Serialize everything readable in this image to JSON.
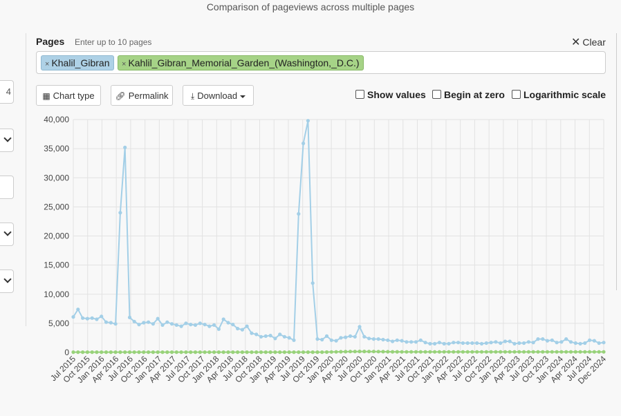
{
  "header": {
    "title": "Comparison of pageviews across multiple pages"
  },
  "left_panel": {
    "field_value": "4"
  },
  "pages": {
    "label": "Pages",
    "hint": "Enter up to 10 pages",
    "clear_label": "Clear",
    "tags": [
      "Khalil_Gibran",
      "Kahlil_Gibran_Memorial_Garden_(Washington,_D.C.)"
    ]
  },
  "toolbar": {
    "chart_type_label": "Chart type",
    "permalink_label": "Permalink",
    "download_label": "Download",
    "show_values_label": "Show values",
    "begin_at_zero_label": "Begin at zero",
    "log_scale_label": "Logarithmic scale"
  },
  "colors": {
    "series1": "#a3cfe7",
    "series2": "#98d27a",
    "grid": "#e2e2e2"
  },
  "chart_data": {
    "type": "line",
    "ylim": [
      0,
      40000
    ],
    "yticks": [
      0,
      5000,
      10000,
      15000,
      20000,
      25000,
      30000,
      35000,
      40000
    ],
    "ytick_labels": [
      "0",
      "5,000",
      "10,000",
      "15,000",
      "20,000",
      "25,000",
      "30,000",
      "35,000",
      "40,000"
    ],
    "x_start": "Jul 2015",
    "x_end": "Dec 2024",
    "xtick_labels": [
      "Jul 2015",
      "Oct 2015",
      "Jan 2016",
      "Apr 2016",
      "Jul 2016",
      "Oct 2016",
      "Jan 2017",
      "Apr 2017",
      "Jul 2017",
      "Oct 2017",
      "Jan 2018",
      "Apr 2018",
      "Jul 2018",
      "Oct 2018",
      "Jan 2019",
      "Apr 2019",
      "Jul 2019",
      "Oct 2019",
      "Jan 2020",
      "Apr 2020",
      "Jul 2020",
      "Oct 2020",
      "Jan 2021",
      "Apr 2021",
      "Jul 2021",
      "Oct 2021",
      "Jan 2022",
      "Apr 2022",
      "Jul 2022",
      "Oct 2022",
      "Jan 2023",
      "Apr 2023",
      "Jul 2023",
      "Oct 2023",
      "Jan 2024",
      "Apr 2024",
      "Jul 2024",
      "Dec 2024"
    ],
    "series": [
      {
        "values": [
          6100,
          7400,
          5900,
          5800,
          5900,
          5700,
          6200,
          5200,
          5100,
          4900,
          24000,
          35200,
          6000,
          5300,
          4800,
          5100,
          5200,
          4900,
          5800,
          4700,
          5200,
          4900,
          4700,
          4500,
          5000,
          4800,
          4700,
          5000,
          4800,
          4500,
          4700,
          4000,
          5700,
          5100,
          4800,
          4100,
          3900,
          4500,
          3300,
          3100,
          2700,
          2800,
          2900,
          2400,
          3100,
          2700,
          2500,
          2100,
          23800,
          35900,
          39800,
          11900,
          2300,
          2200,
          2800,
          2100,
          2000,
          2500,
          2600,
          2800,
          2700,
          4400,
          2700,
          2400,
          2300,
          2300,
          2200,
          2100,
          1900,
          2100,
          2000,
          1800,
          1800,
          1800,
          2100,
          1700,
          1500,
          1500,
          1700,
          1500,
          1500,
          1700,
          1700,
          1600,
          1600,
          1600,
          1600,
          1500,
          1600,
          1700,
          1800,
          1600,
          1900,
          1900,
          1500,
          1600,
          1600,
          1800,
          1700,
          2300,
          2300,
          2000,
          2100,
          1700,
          1800,
          2300,
          1800,
          1600,
          1500,
          1600,
          2100,
          2000,
          1600,
          1700
        ]
      },
      {
        "values": [
          50,
          50,
          50,
          50,
          50,
          50,
          50,
          50,
          50,
          50,
          50,
          50,
          50,
          50,
          50,
          50,
          50,
          50,
          50,
          50,
          50,
          50,
          50,
          50,
          50,
          50,
          50,
          50,
          50,
          50,
          50,
          50,
          50,
          50,
          50,
          50,
          50,
          50,
          50,
          50,
          50,
          50,
          50,
          50,
          50,
          50,
          50,
          50,
          50,
          50,
          50,
          50,
          50,
          50,
          60,
          80,
          100,
          120,
          130,
          150,
          160,
          170,
          170,
          160,
          150,
          140,
          130,
          120,
          110,
          110,
          100,
          100,
          100,
          100,
          100,
          100,
          100,
          100,
          100,
          100,
          100,
          100,
          100,
          100,
          100,
          100,
          100,
          100,
          100,
          100,
          100,
          100,
          100,
          100,
          100,
          100,
          100,
          100,
          100,
          100,
          100,
          100,
          100,
          100,
          100,
          100,
          100,
          100,
          100,
          100,
          100,
          100,
          100,
          100
        ]
      }
    ]
  }
}
